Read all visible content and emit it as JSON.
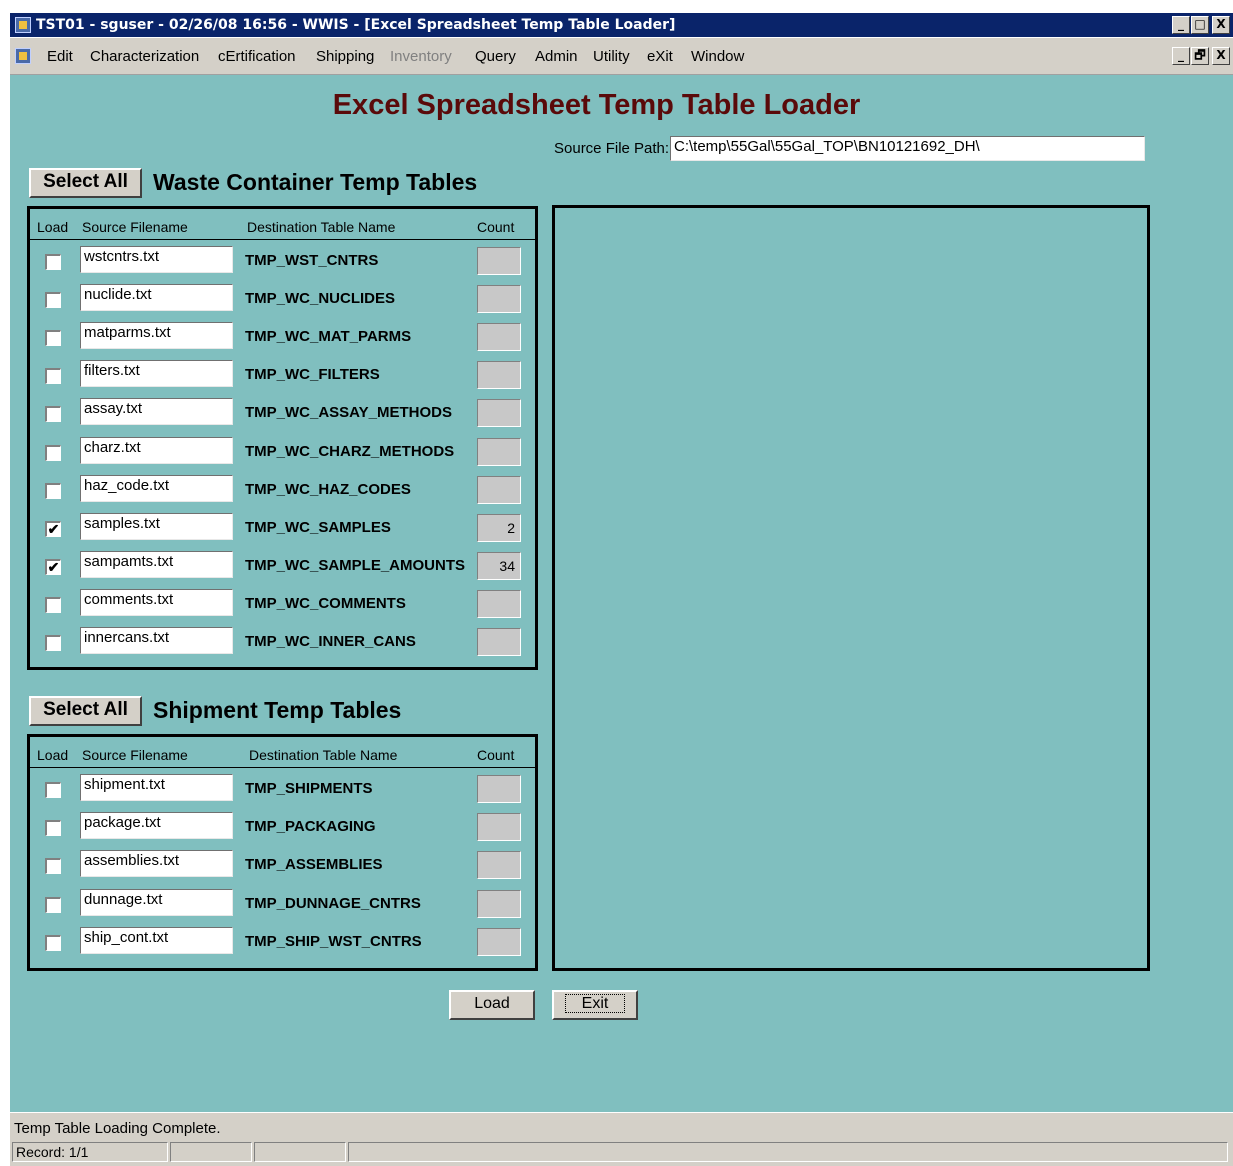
{
  "window": {
    "title": "TST01 - sguser - 02/26/08 16:56 - WWIS - [Excel Spreadsheet Temp Table Loader]",
    "title_buttons": [
      "_",
      "□",
      "X"
    ],
    "menu_buttons": [
      "_",
      "🗗",
      "X"
    ]
  },
  "menu": [
    {
      "label": "Edit",
      "enabled": true
    },
    {
      "label": "Characterization",
      "enabled": true
    },
    {
      "label": "cErtification",
      "enabled": true
    },
    {
      "label": "Shipping",
      "enabled": true
    },
    {
      "label": "Inventory",
      "enabled": false
    },
    {
      "label": "Query",
      "enabled": true
    },
    {
      "label": "Admin",
      "enabled": true
    },
    {
      "label": "Utility",
      "enabled": true
    },
    {
      "label": "eXit",
      "enabled": true
    },
    {
      "label": "Window",
      "enabled": true
    }
  ],
  "form": {
    "title": "Excel Spreadsheet Temp Table Loader",
    "source_path_label": "Source File Path:",
    "source_path_value": "C:\\temp\\55Gal\\55Gal_TOP\\BN10121692_DH\\"
  },
  "columns": {
    "load": "Load",
    "source": "Source Filename",
    "dest": "Destination Table Name",
    "count": "Count"
  },
  "waste": {
    "select_all_label": "Select All",
    "section_title": "Waste Container Temp Tables",
    "rows": [
      {
        "file": "wstcntrs.txt",
        "table": "TMP_WST_CNTRS",
        "checked": "",
        "count": ""
      },
      {
        "file": "nuclide.txt",
        "table": "TMP_WC_NUCLIDES",
        "checked": "",
        "count": ""
      },
      {
        "file": "matparms.txt",
        "table": "TMP_WC_MAT_PARMS",
        "checked": "",
        "count": ""
      },
      {
        "file": "filters.txt",
        "table": "TMP_WC_FILTERS",
        "checked": "",
        "count": ""
      },
      {
        "file": "assay.txt",
        "table": "TMP_WC_ASSAY_METHODS",
        "checked": "",
        "count": ""
      },
      {
        "file": "charz.txt",
        "table": "TMP_WC_CHARZ_METHODS",
        "checked": "",
        "count": ""
      },
      {
        "file": "haz_code.txt",
        "table": "TMP_WC_HAZ_CODES",
        "checked": "",
        "count": ""
      },
      {
        "file": "samples.txt",
        "table": "TMP_WC_SAMPLES",
        "checked": "✔",
        "count": "2"
      },
      {
        "file": "sampamts.txt",
        "table": "TMP_WC_SAMPLE_AMOUNTS",
        "checked": "✔",
        "count": "34"
      },
      {
        "file": "comments.txt",
        "table": "TMP_WC_COMMENTS",
        "checked": "",
        "count": ""
      },
      {
        "file": "innercans.txt",
        "table": "TMP_WC_INNER_CANS",
        "checked": "",
        "count": ""
      }
    ]
  },
  "shipment": {
    "select_all_label": "Select All",
    "section_title": "Shipment Temp Tables",
    "rows": [
      {
        "file": "shipment.txt",
        "table": "TMP_SHIPMENTS",
        "checked": "",
        "count": ""
      },
      {
        "file": "package.txt",
        "table": "TMP_PACKAGING",
        "checked": "",
        "count": ""
      },
      {
        "file": "assemblies.txt",
        "table": "TMP_ASSEMBLIES",
        "checked": "",
        "count": ""
      },
      {
        "file": "dunnage.txt",
        "table": "TMP_DUNNAGE_CNTRS",
        "checked": "",
        "count": ""
      },
      {
        "file": "ship_cont.txt",
        "table": "TMP_SHIP_WST_CNTRS",
        "checked": "",
        "count": ""
      }
    ]
  },
  "buttons": {
    "load": "Load",
    "exit": "Exit"
  },
  "status": {
    "message": "Temp Table Loading Complete.",
    "record": "Record: 1/1"
  },
  "colors": {
    "form_bg": "#80bfbf",
    "title_text": "#5a0a0a",
    "titlebar": "#0a246a"
  }
}
